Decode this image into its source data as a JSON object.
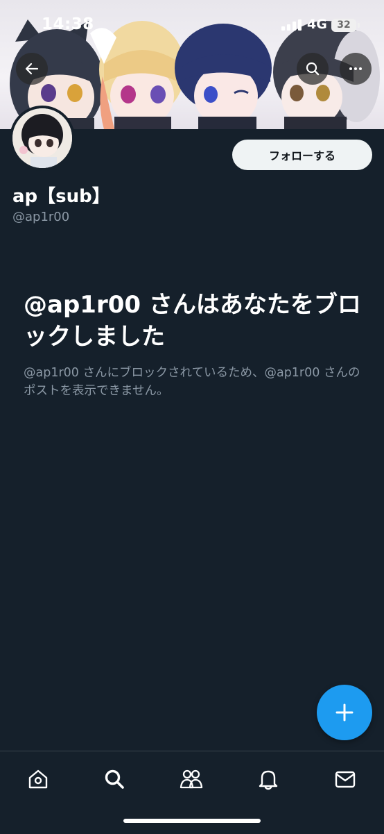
{
  "status_bar": {
    "time": "14:38",
    "network": "4G",
    "battery": "32"
  },
  "header": {
    "back_icon": "arrow-left-icon",
    "search_icon": "search-icon",
    "more_icon": "more-horizontal-icon"
  },
  "profile": {
    "display_name": "ap【sub】",
    "handle": "@ap1r00",
    "follow_label": "フォローする"
  },
  "blocked": {
    "title": "@ap1r00 さんはあなたをブロックしました",
    "description": "@ap1r00 さんにブロックされているため、@ap1r00 さんのポストを表示できません。"
  },
  "fab": {
    "icon": "plus-icon"
  },
  "tab_bar": {
    "items": [
      {
        "icon": "home-icon"
      },
      {
        "icon": "search-icon"
      },
      {
        "icon": "people-icon"
      },
      {
        "icon": "bell-icon"
      },
      {
        "icon": "mail-icon"
      }
    ]
  },
  "colors": {
    "background": "#15202b",
    "accent": "#1d9bf0",
    "secondary_text": "#8b98a5",
    "divider": "#38444d"
  }
}
